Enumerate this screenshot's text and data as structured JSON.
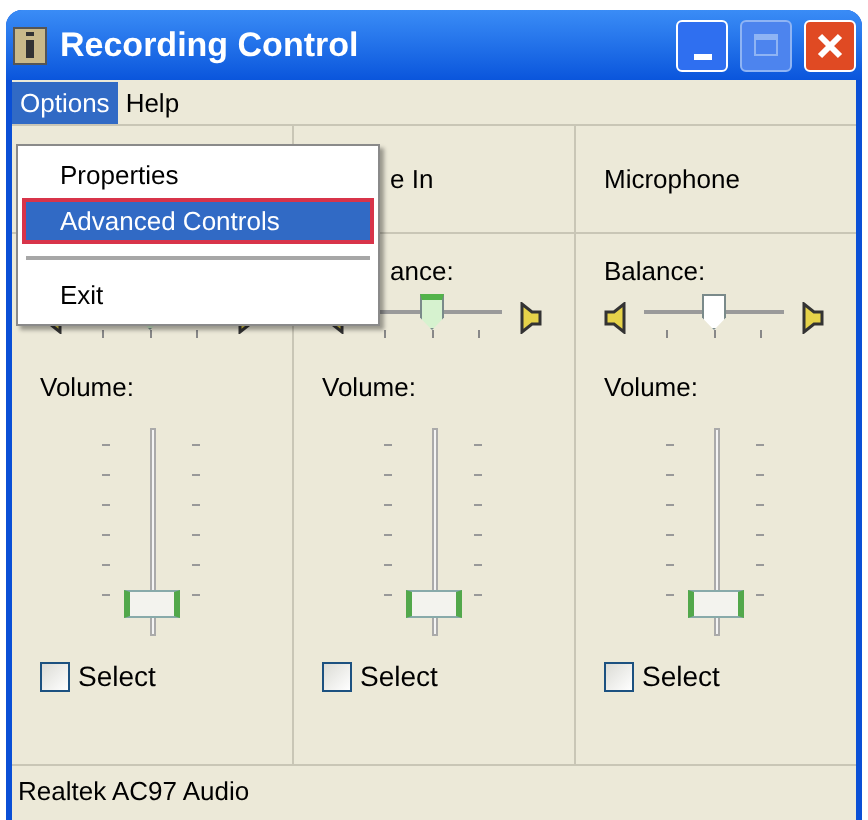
{
  "window": {
    "title": "Recording Control"
  },
  "menu_bar": [
    {
      "label": "Options",
      "selected": true
    },
    {
      "label": "Help",
      "selected": false
    }
  ],
  "open_menu": {
    "items": [
      {
        "kind": "item",
        "label": "Properties",
        "selected": false,
        "outlined": false
      },
      {
        "kind": "item",
        "label": "Advanced Controls",
        "selected": true,
        "outlined": true
      },
      {
        "kind": "separator"
      },
      {
        "kind": "item",
        "label": "Exit",
        "selected": false,
        "outlined": false
      }
    ]
  },
  "channels": [
    {
      "balance": {
        "level": 0.5,
        "highlighted": true
      },
      "volume_label": "Volume:",
      "volume": {
        "level": 0.1
      },
      "select": {
        "label": "Select",
        "checked": false
      }
    },
    {
      "name": "e In",
      "balance_label": "ance:",
      "balance": {
        "level": 0.5,
        "highlighted": true
      },
      "volume_label": "Volume:",
      "volume": {
        "level": 0.1
      },
      "select": {
        "label": "Select",
        "checked": false
      }
    },
    {
      "name": "Microphone",
      "balance_label": "Balance:",
      "balance": {
        "level": 0.5,
        "highlighted": false
      },
      "volume_label": "Volume:",
      "volume": {
        "level": 0.1
      },
      "select": {
        "label": "Select",
        "checked": false
      }
    }
  ],
  "status_bar": "Realtek AC97 Audio"
}
